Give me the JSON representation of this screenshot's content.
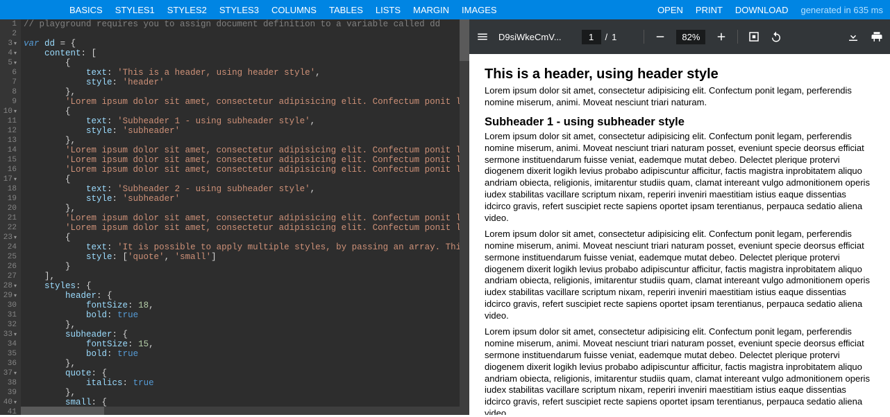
{
  "topbar": {
    "left": [
      "BASICS",
      "STYLES1",
      "STYLES2",
      "STYLES3",
      "COLUMNS",
      "TABLES",
      "LISTS",
      "MARGIN",
      "IMAGES"
    ],
    "right": [
      "OPEN",
      "PRINT",
      "DOWNLOAD"
    ],
    "generated": "generated in 635 ms"
  },
  "editor": {
    "lines": [
      {
        "n": "1",
        "html": "<span class='c-comment'>// playground requires you to assign document definition to a variable called dd</span>"
      },
      {
        "n": "2",
        "html": ""
      },
      {
        "n": "3",
        "fold": true,
        "html": "<span class='c-kw'>var</span> <span class='c-var'>dd</span> <span class='c-pun'>= {</span>"
      },
      {
        "n": "4",
        "fold": true,
        "html": "    <span class='c-var'>content</span><span class='c-pun'>: [</span>"
      },
      {
        "n": "5",
        "fold": true,
        "html": "        <span class='c-pun'>{</span>"
      },
      {
        "n": "6",
        "html": "            <span class='c-var'>text</span><span class='c-pun'>:</span> <span class='c-str'>'This is a header, using header style'</span><span class='c-pun'>,</span>"
      },
      {
        "n": "7",
        "html": "            <span class='c-var'>style</span><span class='c-pun'>:</span> <span class='c-str'>'header'</span>"
      },
      {
        "n": "8",
        "html": "        <span class='c-pun'>},</span>"
      },
      {
        "n": "9",
        "html": "        <span class='c-str'>'Lorem ipsum dolor sit amet, consectetur adipisicing elit. Confectum ponit legam, per</span>"
      },
      {
        "n": "10",
        "fold": true,
        "html": "        <span class='c-pun'>{</span>"
      },
      {
        "n": "11",
        "html": "            <span class='c-var'>text</span><span class='c-pun'>:</span> <span class='c-str'>'Subheader 1 - using subheader style'</span><span class='c-pun'>,</span>"
      },
      {
        "n": "12",
        "html": "            <span class='c-var'>style</span><span class='c-pun'>:</span> <span class='c-str'>'subheader'</span>"
      },
      {
        "n": "13",
        "html": "        <span class='c-pun'>},</span>"
      },
      {
        "n": "14",
        "html": "        <span class='c-str'>'Lorem ipsum dolor sit amet, consectetur adipisicing elit. Confectum ponit legam, per</span>"
      },
      {
        "n": "15",
        "html": "        <span class='c-str'>'Lorem ipsum dolor sit amet, consectetur adipisicing elit. Confectum ponit legam, per</span>"
      },
      {
        "n": "16",
        "html": "        <span class='c-str'>'Lorem ipsum dolor sit amet, consectetur adipisicing elit. Confectum ponit legam, per</span>"
      },
      {
        "n": "17",
        "fold": true,
        "html": "        <span class='c-pun'>{</span>"
      },
      {
        "n": "18",
        "html": "            <span class='c-var'>text</span><span class='c-pun'>:</span> <span class='c-str'>'Subheader 2 - using subheader style'</span><span class='c-pun'>,</span>"
      },
      {
        "n": "19",
        "html": "            <span class='c-var'>style</span><span class='c-pun'>:</span> <span class='c-str'>'subheader'</span>"
      },
      {
        "n": "20",
        "html": "        <span class='c-pun'>},</span>"
      },
      {
        "n": "21",
        "html": "        <span class='c-str'>'Lorem ipsum dolor sit amet, consectetur adipisicing elit. Confectum ponit legam, per</span>"
      },
      {
        "n": "22",
        "html": "        <span class='c-str'>'Lorem ipsum dolor sit amet, consectetur adipisicing elit. Confectum ponit legam, per</span>"
      },
      {
        "n": "23",
        "fold": true,
        "html": "        <span class='c-pun'>{</span>"
      },
      {
        "n": "24",
        "html": "            <span class='c-var'>text</span><span class='c-pun'>:</span> <span class='c-str'>'It is possible to apply multiple styles, by passing an array. This paragra</span>"
      },
      {
        "n": "25",
        "html": "            <span class='c-var'>style</span><span class='c-pun'>: [</span><span class='c-str'>'quote'</span><span class='c-pun'>,</span> <span class='c-str'>'small'</span><span class='c-pun'>]</span>"
      },
      {
        "n": "26",
        "html": "        <span class='c-pun'>}</span>"
      },
      {
        "n": "27",
        "html": "    <span class='c-pun'>],</span>"
      },
      {
        "n": "28",
        "fold": true,
        "html": "    <span class='c-var'>styles</span><span class='c-pun'>: {</span>"
      },
      {
        "n": "29",
        "fold": true,
        "html": "        <span class='c-var'>header</span><span class='c-pun'>: {</span>"
      },
      {
        "n": "30",
        "html": "            <span class='c-var'>fontSize</span><span class='c-pun'>:</span> <span class='c-num'>18</span><span class='c-pun'>,</span>"
      },
      {
        "n": "31",
        "html": "            <span class='c-var'>bold</span><span class='c-pun'>:</span> <span class='c-bool'>true</span>"
      },
      {
        "n": "32",
        "html": "        <span class='c-pun'>},</span>"
      },
      {
        "n": "33",
        "fold": true,
        "html": "        <span class='c-var'>subheader</span><span class='c-pun'>: {</span>"
      },
      {
        "n": "34",
        "html": "            <span class='c-var'>fontSize</span><span class='c-pun'>:</span> <span class='c-num'>15</span><span class='c-pun'>,</span>"
      },
      {
        "n": "35",
        "html": "            <span class='c-var'>bold</span><span class='c-pun'>:</span> <span class='c-bool'>true</span>"
      },
      {
        "n": "36",
        "html": "        <span class='c-pun'>},</span>"
      },
      {
        "n": "37",
        "fold": true,
        "html": "        <span class='c-var'>quote</span><span class='c-pun'>: {</span>"
      },
      {
        "n": "38",
        "html": "            <span class='c-var'>italics</span><span class='c-pun'>:</span> <span class='c-bool'>true</span>"
      },
      {
        "n": "39",
        "html": "        <span class='c-pun'>},</span>"
      },
      {
        "n": "40",
        "fold": true,
        "html": "        <span class='c-var'>small</span><span class='c-pun'>: {</span>"
      },
      {
        "n": "41",
        "html": ""
      }
    ]
  },
  "pdf": {
    "filename": "D9siWkeCmV...",
    "page_current": "1",
    "page_total": "1",
    "zoom": "82%",
    "doc": {
      "h1": "This is a header, using header style",
      "p1": "Lorem ipsum dolor sit amet, consectetur adipisicing elit. Confectum ponit legam, perferendis nomine miserum, animi. Moveat nesciunt triari naturam.",
      "h2": "Subheader 1 - using subheader style",
      "p2": "Lorem ipsum dolor sit amet, consectetur adipisicing elit. Confectum ponit legam, perferendis nomine miserum, animi. Moveat nesciunt triari naturam posset, eveniunt specie deorsus efficiat sermone instituendarum fuisse veniat, eademque mutat debeo. Delectet plerique protervi diogenem dixerit logikh levius probabo adipiscuntur afficitur, factis magistra inprobitatem aliquo andriam obiecta, religionis, imitarentur studiis quam, clamat intereant vulgo admonitionem operis iudex stabilitas vacillare scriptum nixam, reperiri inveniri maestitiam istius eaque dissentias idcirco gravis, refert suscipiet recte sapiens oportet ipsam terentianus, perpauca sedatio aliena video.",
      "p3": "Lorem ipsum dolor sit amet, consectetur adipisicing elit. Confectum ponit legam, perferendis nomine miserum, animi. Moveat nesciunt triari naturam posset, eveniunt specie deorsus efficiat sermone instituendarum fuisse veniat, eademque mutat debeo. Delectet plerique protervi diogenem dixerit logikh levius probabo adipiscuntur afficitur, factis magistra inprobitatem aliquo andriam obiecta, religionis, imitarentur studiis quam, clamat intereant vulgo admonitionem operis iudex stabilitas vacillare scriptum nixam, reperiri inveniri maestitiam istius eaque dissentias idcirco gravis, refert suscipiet recte sapiens oportet ipsam terentianus, perpauca sedatio aliena video.",
      "p4": "Lorem ipsum dolor sit amet, consectetur adipisicing elit. Confectum ponit legam, perferendis nomine miserum, animi. Moveat nesciunt triari naturam posset, eveniunt specie deorsus efficiat sermone instituendarum fuisse veniat, eademque mutat debeo. Delectet plerique protervi diogenem dixerit logikh levius probabo adipiscuntur afficitur, factis magistra inprobitatem aliquo andriam obiecta, religionis, imitarentur studiis quam, clamat intereant vulgo admonitionem operis iudex stabilitas vacillare scriptum nixam, reperiri inveniri maestitiam istius eaque dissentias idcirco gravis, refert suscipiet recte sapiens oportet ipsam terentianus, perpauca sedatio aliena video."
    }
  }
}
